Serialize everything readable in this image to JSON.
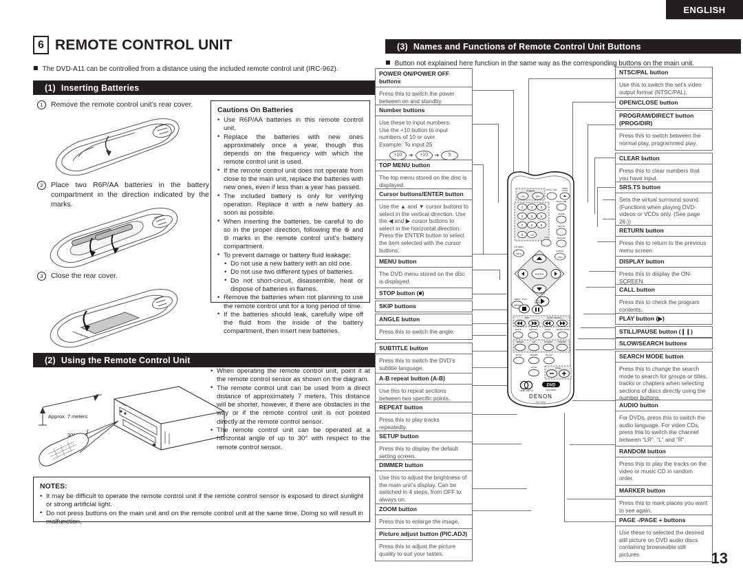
{
  "language_tab": "ENGLISH",
  "page_number": "13",
  "chapter": {
    "number": "6",
    "title": "REMOTE CONTROL UNIT"
  },
  "intro": "The DVD-A11 can be controlled from a distance using the included remote control unit (IRC-962).",
  "sections": {
    "inserting": {
      "number": "(1)",
      "title": "Inserting Batteries"
    },
    "using": {
      "number": "(2)",
      "title": "Using the Remote Control Unit"
    },
    "names": {
      "number": "(3)",
      "title": "Names and Functions of Remote Control Unit Buttons"
    }
  },
  "names_intro": "Button not explained here function in the same way as the corresponding buttons on the main unit.",
  "steps": [
    {
      "num": "1",
      "text": "Remove the remote control unit’s rear cover."
    },
    {
      "num": "2",
      "text": "Place two R6P/AA batteries in the battery compartment in the direction indicated by the marks."
    },
    {
      "num": "3",
      "text": "Close the rear cover."
    }
  ],
  "cautions": {
    "title": "Cautions On Batteries",
    "items": [
      {
        "level": 0,
        "text": "Use R6P/AA batteries in this remote control unit."
      },
      {
        "level": 0,
        "text": "Replace the batteries with new ones approximately once a year, though this depends on the frequency with which the remote control unit is used."
      },
      {
        "level": 0,
        "text": "If the remote control unit does not operate from close to the main unit, replace the batteries with new ones, even if less than a year has passed."
      },
      {
        "level": 0,
        "text": "The included battery is only for verifying operation. Replace it with a new battery as soon as possible."
      },
      {
        "level": 0,
        "text": "When inserting the batteries, be careful to do so in the proper direction, following the ⊕ and ⊖ marks in the remote control unit's battery compartment."
      },
      {
        "level": 0,
        "text": "To prevent damage or battery fluid leakage:"
      },
      {
        "level": 1,
        "text": "Do not use a new battery with an old one."
      },
      {
        "level": 1,
        "text": "Do not use two different types of batteries."
      },
      {
        "level": 1,
        "text": "Do not short-circuit, disassemble, heat or dispose of batteries in flames."
      },
      {
        "level": 0,
        "text": "Remove the batteries when not planning to use the remote control unit for a long period of time."
      },
      {
        "level": 0,
        "text": "If the batteries should leak, carefully wipe off the fluid from the inside of the battery compartment, then insert new batteries."
      }
    ]
  },
  "using_bullets": [
    "When operating the remote control unit, point it at the remote control sensor as shown on the diagram.",
    "The remote control unit can be used from a direct distance of approximately 7 meters. This distance will be shorter, however, if there are obstacles in the way or if the remote control unit is not pointed directly at the remote control sensor.",
    "The remote control unit can be operated at a horizontal angle of up to 30° with respect to the remote control sensor."
  ],
  "diagram_labels": {
    "distance": "Approx. 7 meters",
    "angle_top": "30°",
    "angle_bottom": "30°"
  },
  "notes": {
    "title": "NOTES:",
    "items": [
      "It may be difficult to operate the remote control unit if the remote control sensor is exposed to direct sunlight or strong artificial light.",
      "Do not press buttons on the main unit and on the remote control unit at the same time. Doing so will result in malfunction."
    ]
  },
  "callouts_left": [
    {
      "head": "POWER ON/POWER OFF buttons",
      "body": "Press this to switch the power between on and standby."
    },
    {
      "head": "Number buttons",
      "body": "Use these to input numbers.\nUse the +10 button to input numbers of 10 or over.\nExample: To input 25",
      "example": [
        "+10",
        "+10",
        "5"
      ]
    },
    {
      "head": "TOP MENU button",
      "body": "The top menu stored on the disc is displayed."
    },
    {
      "head": "Cursor buttons/ENTER button",
      "body": "Use the ▲ and ▼ cursor buttons to select in the vertical direction. Use the ◀ and ▶ cursor buttons to select in the horizontal direction.\nPress the ENTER button to select the item selected with the cursor buttons."
    },
    {
      "head": "MENU button",
      "body": "The DVD menu stored on the disc is displayed."
    },
    {
      "head": "STOP button (■)",
      "body": ""
    },
    {
      "head": "SKIP buttons",
      "body": ""
    },
    {
      "head": "ANGLE button",
      "body": "Press this to switch the angle."
    },
    {
      "head": "SUBTITLE button",
      "body": "Press this to switch the DVD’s subtitle language."
    },
    {
      "head": "A-B repeat button (A-B)",
      "body": "Use this to repeat sections between two specific points."
    },
    {
      "head": "REPEAT button",
      "body": "Press this to play tracks repeatedly."
    },
    {
      "head": "SETUP button",
      "body": "Press this to display the default setting screen."
    },
    {
      "head": "DIMMER button",
      "body": "Use this to adjust the brightness of the main unit’s display. Can be switched in 4 steps, from OFF to always on."
    },
    {
      "head": "ZOOM button",
      "body": "Press this to enlarge the image."
    },
    {
      "head": "Picture adjust button (PIC.ADJ)",
      "body": "Press this to adjust the picture quality to suit your tastes."
    }
  ],
  "callouts_right": [
    {
      "head": "NTSC/PAL button",
      "body": "Use this to switch the set’s video output format (NTSC/PAL)."
    },
    {
      "head": "OPEN/CLOSE button",
      "body": ""
    },
    {
      "head": "PROGRAM/DIRECT button (PROG/DIR)",
      "body": "Press this to switch between the normal play, programmed play."
    },
    {
      "head": "CLEAR button",
      "body": "Press this to clear numbers that you have input."
    },
    {
      "head": "SRS.TS button",
      "body": "Sets the virtual surround sound. (Functions when playing DVD-videos or VCDs only. (See page 26.))"
    },
    {
      "head": "RETURN button",
      "body": "Press this to return to the previous menu screen."
    },
    {
      "head": "DISPLAY button",
      "body": "Press this to display the ON-SCREEN."
    },
    {
      "head": "CALL button",
      "body": "Press this to check the program contents."
    },
    {
      "head": "PLAY button (▶)",
      "body": ""
    },
    {
      "head": "STILL/PAUSE button (❙❙)",
      "body": ""
    },
    {
      "head": "SLOW/SEARCH buttons",
      "body": ""
    },
    {
      "head": "SEARCH MODE button",
      "body": "Press this to change the search mode to search for groups or titles, tracks or chapters when selecting sections of discs directly using the number buttons."
    },
    {
      "head": "AUDIO button",
      "body": "For DVDs, press this to switch the audio language. For video CDs, press this to switch the channel between “LR”, “L” and “R”."
    },
    {
      "head": "RANDOM button",
      "body": "Press this to play the tracks on the video or music CD in random order."
    },
    {
      "head": "MARKER button",
      "body": "Press this to mark places you want to see again."
    },
    {
      "head": "PAGE -/PAGE + buttons",
      "body": "Use these to selected the desired still picture on DVD audio discs containing browseable still pictures."
    }
  ],
  "remote": {
    "brand": "DENON",
    "model": "RC-962",
    "logos": [
      "SUPER AUDIO CD",
      "DVD AUDIO/VIDEO"
    ],
    "labels": {
      "power": "POWER",
      "power_on": "ON",
      "power_off": "OFF",
      "ntsc_pal": "NTSC / PAL",
      "open_close": "OPEN/CLOSE",
      "prog_dir": "PROG / DIR",
      "clear": "CLEAR",
      "srs_ts": "SRS.TS",
      "top_menu": "TOP MENU",
      "menu_short": "T.MNU",
      "call": "CALL",
      "return": "RETURN",
      "display": "DISP",
      "enter": "ENTER",
      "menu": "MENU",
      "stop": "STOP",
      "play": "PLAY",
      "still_pause": "STILL/PAUSE",
      "skip": "SKIP",
      "slow_search": "SLOW / SEARCH",
      "angle": "ANGLE",
      "subtitle": "SUBTITLE",
      "audio": "AUDIO",
      "search_mode": "SEARCH MODE",
      "repeat": "REPEAT",
      "ab": "A-B",
      "random": "RANDOM",
      "marker": "MARKER",
      "setup": "SETUP",
      "dimmer": "DIMMER",
      "pic_adj": "PIC.ADJ",
      "zoom": "ZOOM",
      "page": "PAGE",
      "page_minus": "−",
      "page_plus": "+",
      "num0": "0",
      "num1": "1",
      "num2": "2",
      "num3": "3",
      "num4": "4",
      "num5": "5",
      "num6": "6",
      "num7": "7",
      "num8": "8",
      "num9": "9",
      "plus10": "+10"
    }
  }
}
